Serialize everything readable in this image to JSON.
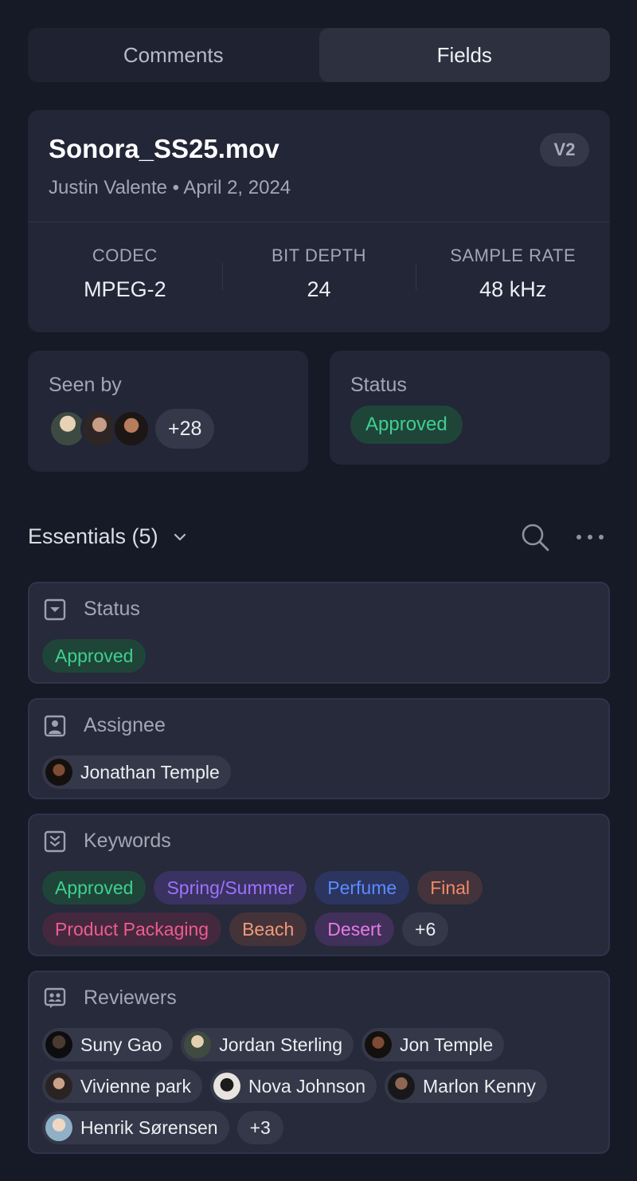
{
  "tabs": [
    {
      "label": "Comments",
      "active": false
    },
    {
      "label": "Fields",
      "active": true
    }
  ],
  "file": {
    "name": "Sonora_SS25.mov",
    "subtitle": "Justin Valente • April 2, 2024",
    "version": "V2",
    "meta": [
      {
        "label": "CODEC",
        "value": "MPEG-2"
      },
      {
        "label": "BIT DEPTH",
        "value": "24"
      },
      {
        "label": "SAMPLE RATE",
        "value": "48 kHz"
      }
    ]
  },
  "seen_by": {
    "label": "Seen by",
    "more": "+28"
  },
  "status_card": {
    "label": "Status",
    "value": "Approved",
    "color": "#3fd08f"
  },
  "section": {
    "title": "Essentials (5)"
  },
  "fields": {
    "status": {
      "label": "Status",
      "value": "Approved"
    },
    "assignee": {
      "label": "Assignee",
      "value": "Jonathan Temple"
    },
    "keywords": {
      "label": "Keywords",
      "items": [
        "Approved",
        "Spring/Summer",
        "Perfume",
        "Final",
        "Product Packaging",
        "Beach",
        "Desert"
      ],
      "more": "+6"
    },
    "reviewers": {
      "label": "Reviewers",
      "items": [
        "Suny Gao",
        "Jordan Sterling",
        "Jon Temple",
        "Vivienne park",
        "Nova Johnson",
        "Marlon Kenny",
        "Henrik Sørensen"
      ],
      "more": "+3"
    }
  },
  "colors": {
    "background": "#161926",
    "card": "#222637",
    "accent_green": "#3fd08f"
  }
}
